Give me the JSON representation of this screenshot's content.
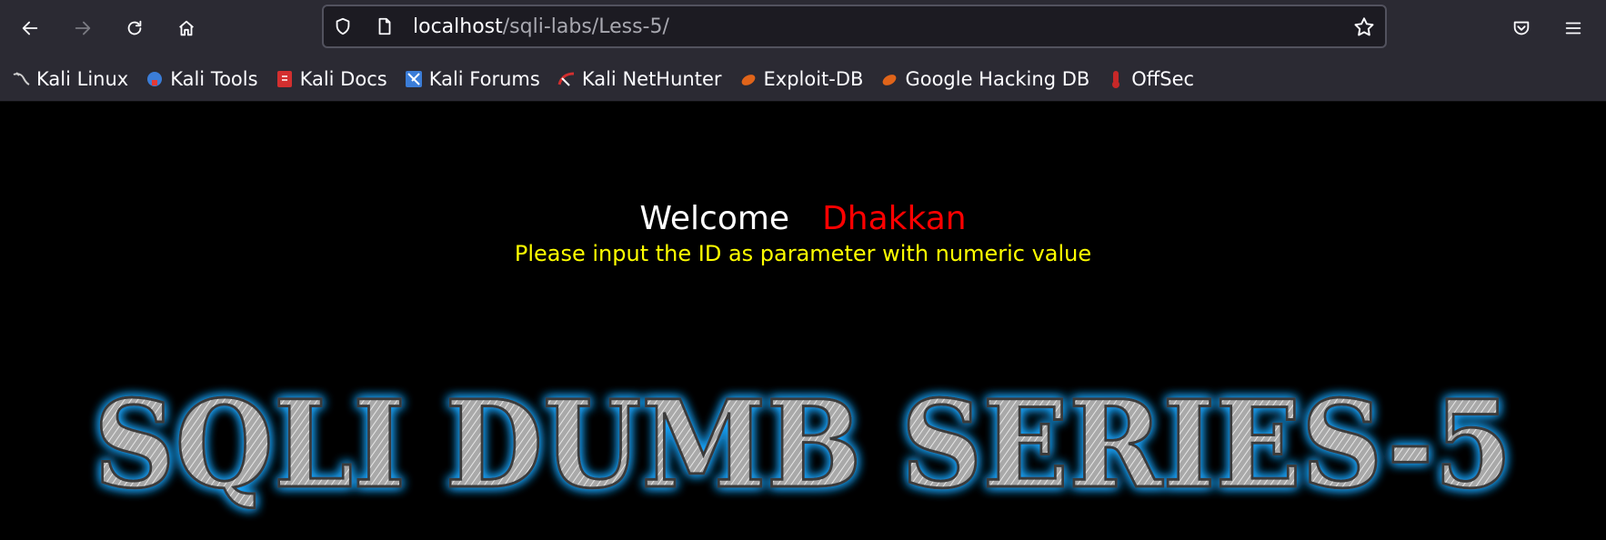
{
  "browser": {
    "url_host": "localhost",
    "url_path": "/sqli-labs/Less-5/"
  },
  "bookmarks": [
    {
      "label": "Kali Linux",
      "icon": "kali-dragon-icon",
      "color": "#cfcfcf"
    },
    {
      "label": "Kali Tools",
      "icon": "kali-tools-icon",
      "color": "#3b7dd8"
    },
    {
      "label": "Kali Docs",
      "icon": "kali-docs-icon",
      "color": "#d32f2f"
    },
    {
      "label": "Kali Forums",
      "icon": "kali-forums-icon",
      "color": "#3b7dd8"
    },
    {
      "label": "Kali NetHunter",
      "icon": "kali-nethunter-icon",
      "color": "#d32f2f"
    },
    {
      "label": "Exploit-DB",
      "icon": "exploit-db-icon",
      "color": "#e0641a"
    },
    {
      "label": "Google Hacking DB",
      "icon": "ghdb-icon",
      "color": "#e0641a"
    },
    {
      "label": "OffSec",
      "icon": "offsec-icon",
      "color": "#c62828"
    }
  ],
  "page": {
    "welcome": "Welcome",
    "user": "Dhakkan",
    "instruction": "Please input the ID as parameter with numeric value",
    "banner_text": "SQLI DUMB SERIES-5"
  },
  "colors": {
    "welcome": "#ffffff",
    "user": "#ff0000",
    "instruction": "#ffff00",
    "banner_glow": "#1ea7ff"
  }
}
